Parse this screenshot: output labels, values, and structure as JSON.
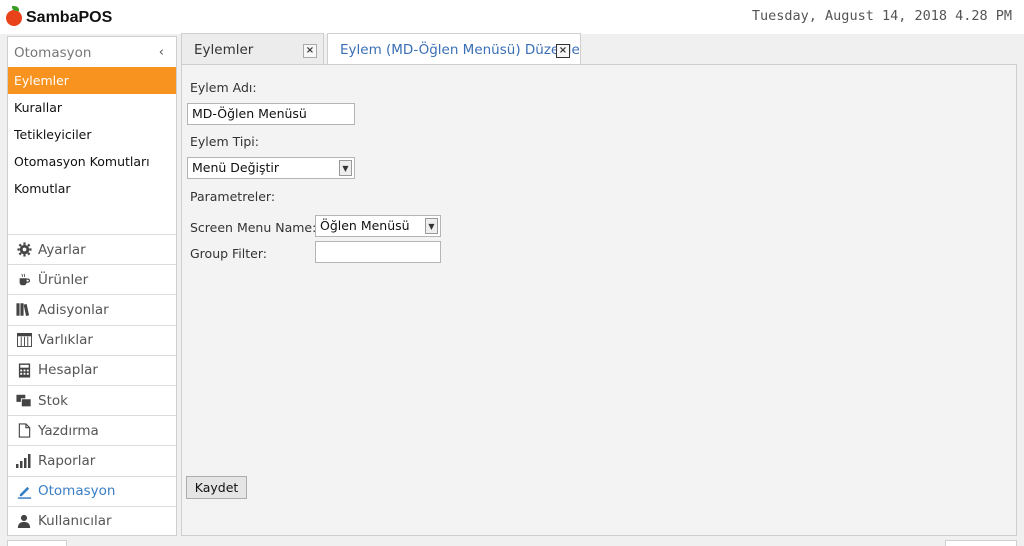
{
  "app": {
    "name": "SambaPOS"
  },
  "clock": "Tuesday, August 14, 2018 4.28 PM",
  "sidebar": {
    "section_title": "Otomasyon",
    "collapse_glyph": "‹",
    "sub_items": [
      {
        "label": "Eylemler",
        "active": true
      },
      {
        "label": "Kurallar"
      },
      {
        "label": "Tetikleyiciler"
      },
      {
        "label": "Otomasyon Komutları"
      },
      {
        "label": "Komutlar"
      }
    ],
    "modules": [
      {
        "label": "Ayarlar",
        "icon": "gear-icon"
      },
      {
        "label": "Ürünler",
        "icon": "coffee-cup-icon"
      },
      {
        "label": "Adisyonlar",
        "icon": "books-icon"
      },
      {
        "label": "Varlıklar",
        "icon": "table-icon"
      },
      {
        "label": "Hesaplar",
        "icon": "calculator-icon"
      },
      {
        "label": "Stok",
        "icon": "boxes-icon"
      },
      {
        "label": "Yazdırma",
        "icon": "document-icon"
      },
      {
        "label": "Raporlar",
        "icon": "bar-chart-icon"
      },
      {
        "label": "Otomasyon",
        "icon": "pencil-icon",
        "current": true
      },
      {
        "label": "Kullanıcılar",
        "icon": "user-icon"
      }
    ]
  },
  "tabs": [
    {
      "label": "Eylemler",
      "close": "×"
    },
    {
      "label": "Eylem (MD-Öğlen Menüsü) Düzenle",
      "close": "×",
      "active": true
    }
  ],
  "form": {
    "action_name_label": "Eylem Adı:",
    "action_name_value": "MD-Öğlen Menüsü",
    "action_type_label": "Eylem Tipi:",
    "action_type_value": "Menü Değiştir",
    "parameters_label": "Parametreler:",
    "screen_menu_label": "Screen Menu Name:",
    "screen_menu_value": "Öğlen Menüsü",
    "group_filter_label": "Group Filter:",
    "group_filter_value": "",
    "save_label": "Kaydet"
  },
  "colors": {
    "active_nav": "#f7931e",
    "accent_blue": "#3a7ec5",
    "logo_red": "#e8431a"
  }
}
